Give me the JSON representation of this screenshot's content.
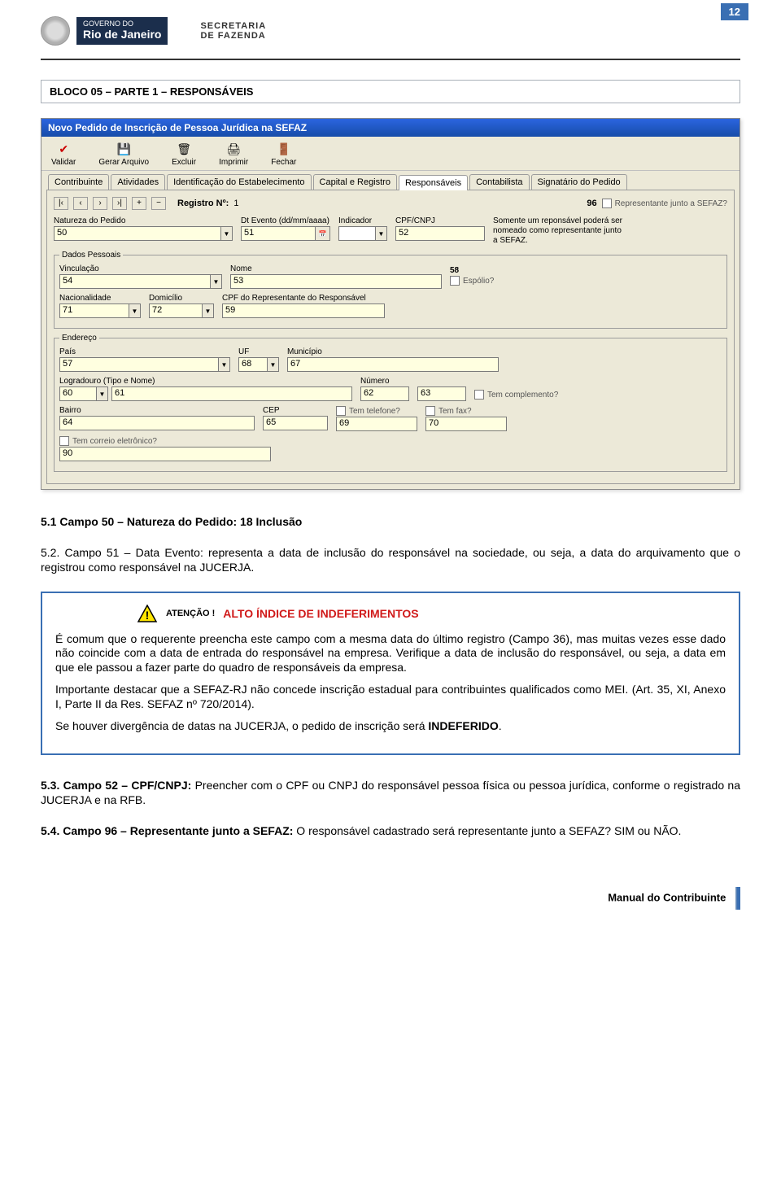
{
  "page_number": "12",
  "header": {
    "governo_line1": "GOVERNO DO",
    "governo_line2": "Rio de Janeiro",
    "secretaria_line1": "SECRETARIA",
    "secretaria_line2": "DE FAZENDA"
  },
  "section_title": "BLOCO 05 – PARTE 1 – RESPONSÁVEIS",
  "app": {
    "title": "Novo Pedido de Inscrição de Pessoa Jurídica na SEFAZ",
    "toolbar": {
      "validar": "Validar",
      "gerar": "Gerar Arquivo",
      "excluir": "Excluir",
      "imprimir": "Imprimir",
      "fechar": "Fechar"
    },
    "tabs": {
      "contribuinte": "Contribuinte",
      "atividades": "Atividades",
      "identificacao": "Identificação do Estabelecimento",
      "capital": "Capital e Registro",
      "responsaveis": "Responsáveis",
      "contabilista": "Contabilista",
      "signatario": "Signatário do Pedido"
    },
    "registro_label": "Registro Nº:",
    "registro_valor": "1",
    "rep_96": "96",
    "rep_label": "Representante junto a SEFAZ?",
    "rep_note": "Somente um reponsável poderá ser nomeado como representante junto a SEFAZ.",
    "natureza_label": "Natureza do Pedido",
    "natureza": "50",
    "dtevento_label": "Dt Evento (dd/mm/aaaa)",
    "dtevento": "51",
    "indicador_label": "Indicador",
    "indicador_cpf": "CPF/CNPJ",
    "indicador": "52",
    "dados_legend": "Dados Pessoais",
    "vinculacao_label": "Vinculação",
    "vinculacao": "54",
    "nome_label": "Nome",
    "nome": "53",
    "espolio_label": "Espólio?",
    "espolio_num": "58",
    "nacionalidade_label": "Nacionalidade",
    "nacionalidade": "71",
    "domicilio_label": "Domicílio",
    "domicilio": "72",
    "cpfrep_label": "CPF do Representante do Responsável",
    "cpfrep": "59",
    "endereco_legend": "Endereço",
    "pais_label": "País",
    "pais": "57",
    "uf_label": "UF",
    "uf": "68",
    "municipio_label": "Município",
    "municipio": "67",
    "logradouro_label": "Logradouro (Tipo e Nome)",
    "lograd_a": "60",
    "lograd_b": "61",
    "numero_label": "Número",
    "numero": "62",
    "complemento_num": "63",
    "tem_complemento": "Tem complemento?",
    "bairro_label": "Bairro",
    "bairro": "64",
    "cep_label": "CEP",
    "cep": "65",
    "tem_telefone": "Tem telefone?",
    "telefone": "69",
    "tem_fax": "Tem fax?",
    "fax": "70",
    "tem_correio": "Tem correio eletrônico?",
    "correio": "90"
  },
  "p51": "5.1 Campo 50 – Natureza do Pedido: 18 Inclusão",
  "p52": "5.2. Campo 51 – Data Evento: representa a data de inclusão do responsável na sociedade, ou seja, a data do arquivamento que o registrou como responsável na JUCERJA.",
  "alert": {
    "atencao": "ATENÇÃO !",
    "titulo": "ALTO ÍNDICE DE INDEFERIMENTOS",
    "p1": "É comum que o requerente preencha este campo com a mesma data do último registro (Campo 36), mas muitas vezes esse dado não coincide com a data de entrada do responsável na empresa. Verifique a data de inclusão do responsável, ou seja, a data em que ele passou a fazer parte do quadro de responsáveis da empresa.",
    "p2": "Importante destacar que a SEFAZ-RJ não concede inscrição estadual para contribuintes qualificados como MEI. (Art. 35, XI, Anexo I, Parte II da Res. SEFAZ nº 720/2014).",
    "p3_a": "Se houver divergência de datas na JUCERJA, o pedido de inscrição será ",
    "p3_b": "INDEFERIDO",
    "p3_c": "."
  },
  "p53_a": "5.3. Campo 52 – CPF/CNPJ:",
  "p53_b": " Preencher com o CPF ou CNPJ do responsável pessoa física ou pessoa jurídica, conforme o registrado na JUCERJA e na RFB.",
  "p54_a": "5.4. Campo 96 – Representante junto a SEFAZ:",
  "p54_b": " O responsável cadastrado será representante junto a SEFAZ? SIM ou NÃO.",
  "footer": "Manual do Contribuinte"
}
